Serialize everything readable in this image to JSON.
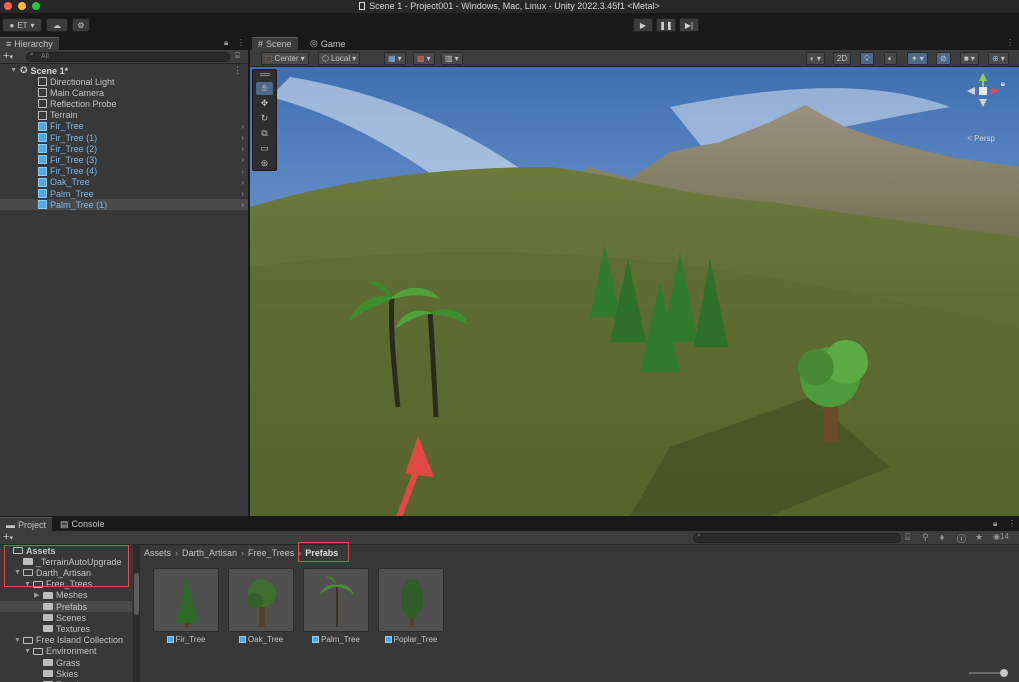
{
  "window": {
    "title": "Scene 1 - Project001 - Windows, Mac, Linux - Unity 2022.3.45f1 <Metal>"
  },
  "toolbar": {
    "account_label": "ET",
    "play_icon": "play-icon",
    "pause_icon": "pause-icon",
    "step_icon": "step-icon"
  },
  "hierarchy": {
    "tab_label": "Hierarchy",
    "search_placeholder": "All",
    "scene_name": "Scene 1*",
    "items": [
      {
        "label": "Directional Light",
        "prefab": false
      },
      {
        "label": "Main Camera",
        "prefab": false
      },
      {
        "label": "Reflection Probe",
        "prefab": false
      },
      {
        "label": "Terrain",
        "prefab": false
      },
      {
        "label": "Fir_Tree",
        "prefab": true
      },
      {
        "label": "Fir_Tree (1)",
        "prefab": true
      },
      {
        "label": "Fir_Tree (2)",
        "prefab": true
      },
      {
        "label": "Fir_Tree (3)",
        "prefab": true
      },
      {
        "label": "Fir_Tree (4)",
        "prefab": true
      },
      {
        "label": "Oak_Tree",
        "prefab": true
      },
      {
        "label": "Palm_Tree",
        "prefab": true
      },
      {
        "label": "Palm_Tree (1)",
        "prefab": true
      }
    ]
  },
  "scene": {
    "tabs": [
      {
        "label": "Scene"
      },
      {
        "label": "Game"
      }
    ],
    "pivot_label": "Center",
    "space_label": "Local",
    "mode_2d_label": "2D",
    "persp_label": "< Persp"
  },
  "project": {
    "tabs": [
      {
        "label": "Project"
      },
      {
        "label": "Console"
      }
    ],
    "visible_count": "14",
    "tree": [
      {
        "label": "Assets",
        "indent": 0,
        "arrow": "",
        "open": true
      },
      {
        "label": "_TerrainAutoUpgrade",
        "indent": 1,
        "arrow": "",
        "open": false
      },
      {
        "label": "Darth_Artisan",
        "indent": 1,
        "arrow": "▼",
        "open": true
      },
      {
        "label": "Free_Trees",
        "indent": 2,
        "arrow": "▼",
        "open": true
      },
      {
        "label": "Meshes",
        "indent": 3,
        "arrow": "▶",
        "open": false
      },
      {
        "label": "Prefabs",
        "indent": 3,
        "arrow": "",
        "open": false
      },
      {
        "label": "Scenes",
        "indent": 3,
        "arrow": "",
        "open": false
      },
      {
        "label": "Textures",
        "indent": 3,
        "arrow": "",
        "open": false
      },
      {
        "label": "Free Island Collection",
        "indent": 1,
        "arrow": "▼",
        "open": true
      },
      {
        "label": "Environment",
        "indent": 2,
        "arrow": "▼",
        "open": true
      },
      {
        "label": "Grass",
        "indent": 3,
        "arrow": "",
        "open": false
      },
      {
        "label": "Skies",
        "indent": 3,
        "arrow": "",
        "open": false
      },
      {
        "label": "Terrain",
        "indent": 3,
        "arrow": "",
        "open": false
      }
    ],
    "breadcrumb": [
      "Assets",
      "Darth_Artisan",
      "Free_Trees",
      "Prefabs"
    ],
    "assets": [
      {
        "label": "Fir_Tree"
      },
      {
        "label": "Oak_Tree"
      },
      {
        "label": "Palm_Tree"
      },
      {
        "label": "Poplar_Tree"
      }
    ]
  },
  "colors": {
    "annotation_red": "#e05050",
    "prefab_blue": "#53a7e3",
    "panel_bg": "#383838"
  }
}
